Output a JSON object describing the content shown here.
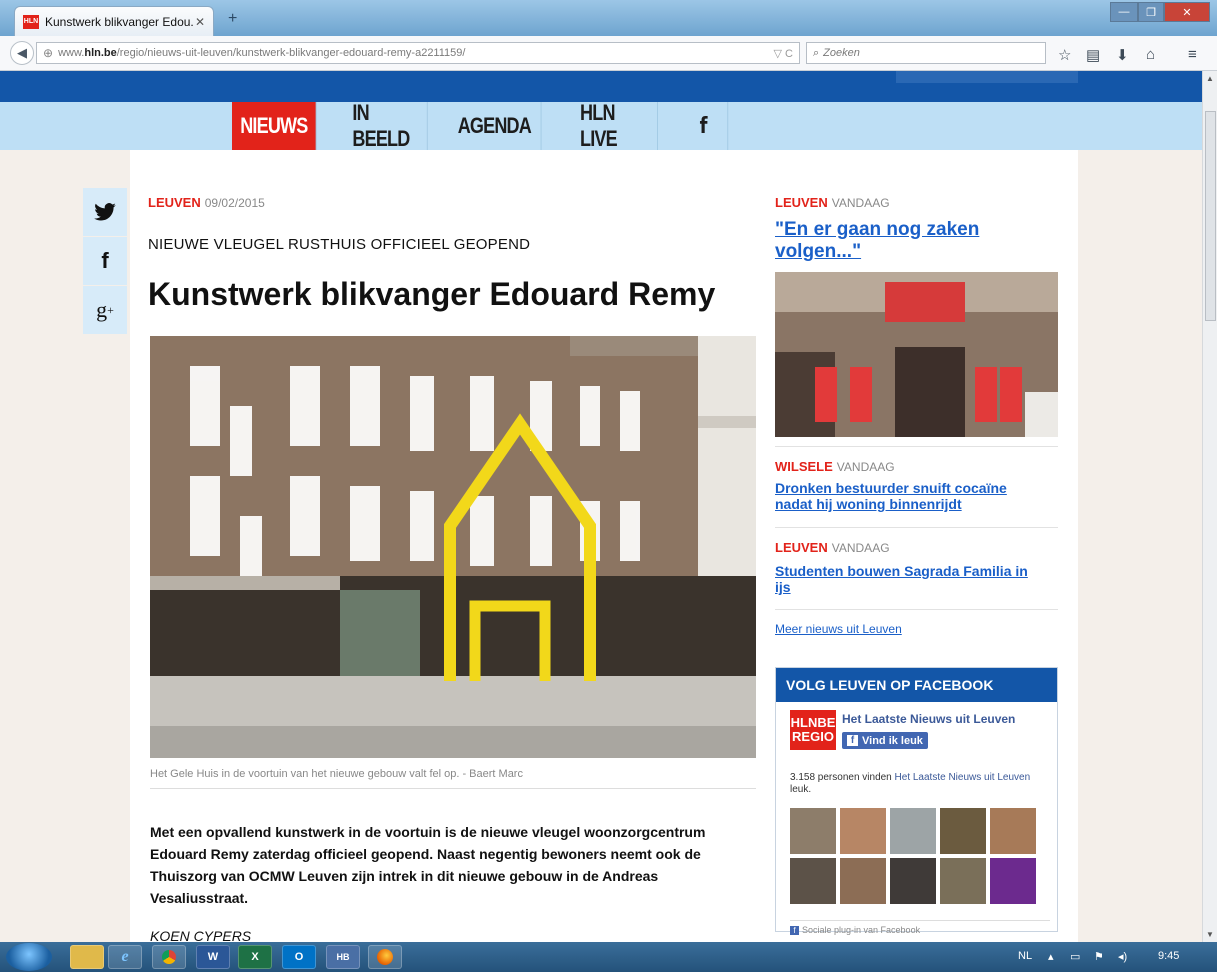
{
  "browser": {
    "tab_title": "Kunstwerk blikvanger Edou...",
    "tab_favicon": "HLN",
    "new_tab": "+",
    "url_host": "www.hln.be",
    "url_prefix": "www.",
    "url_domain": "hln.be",
    "url_path": "/regio/nieuws-uit-leuven/kunstwerk-blikvanger-edouard-remy-a2211159/",
    "search_placeholder": "Zoeken",
    "accent": "#e2231a",
    "brand_blue": "#1356a8"
  },
  "site": {
    "menu": [
      "NIEUWS",
      "IN BEELD",
      "AGENDA",
      "HLN LIVE",
      "f"
    ],
    "share": [
      "twitter-icon",
      "facebook-icon",
      "googleplus-icon"
    ]
  },
  "article": {
    "location": "LEUVEN",
    "date": "09/02/2015",
    "overline": "NIEUWE VLEUGEL RUSTHUIS OFFICIEEL GEOPEND",
    "headline": "Kunstwerk blikvanger Edouard Remy",
    "caption": "Het Gele Huis in de voortuin van het nieuwe gebouw valt fel op. - Baert Marc",
    "lead": "Met een opvallend kunstwerk in de voortuin is de nieuwe vleugel woonzorgcentrum Edouard Remy zaterdag officieel geopend. Naast negentig bewoners neemt ook de Thuiszorg van OCMW Leuven zijn intrek in dit nieuwe gebouw in de Andreas Vesaliusstraat.",
    "author": "KOEN CYPERS"
  },
  "sidebar": {
    "items": [
      {
        "location": "LEUVEN",
        "when": "VANDAAG",
        "title": "\"En er gaan nog zaken volgen...\""
      },
      {
        "location": "WILSELE",
        "when": "VANDAAG",
        "title": "Dronken bestuurder snuift cocaïne nadat hij woning binnenrijdt"
      },
      {
        "location": "LEUVEN",
        "when": "VANDAAG",
        "title": "Studenten bouwen Sagrada Familia in ijs"
      }
    ],
    "more": "Meer nieuws uit Leuven",
    "facebook": {
      "heading": "VOLG LEUVEN OP FACEBOOK",
      "logo": "HLNBE REGIO",
      "page_name": "Het Laatste Nieuws uit Leuven",
      "like": "Vind ik leuk",
      "count_text": "3.158 personen vinden",
      "count_link": "Het Laatste Nieuws uit Leuven",
      "count_suffix": "leuk.",
      "footer": "Sociale plug-in van Facebook"
    }
  },
  "taskbar": {
    "lang": "NL",
    "time": "9:45"
  }
}
